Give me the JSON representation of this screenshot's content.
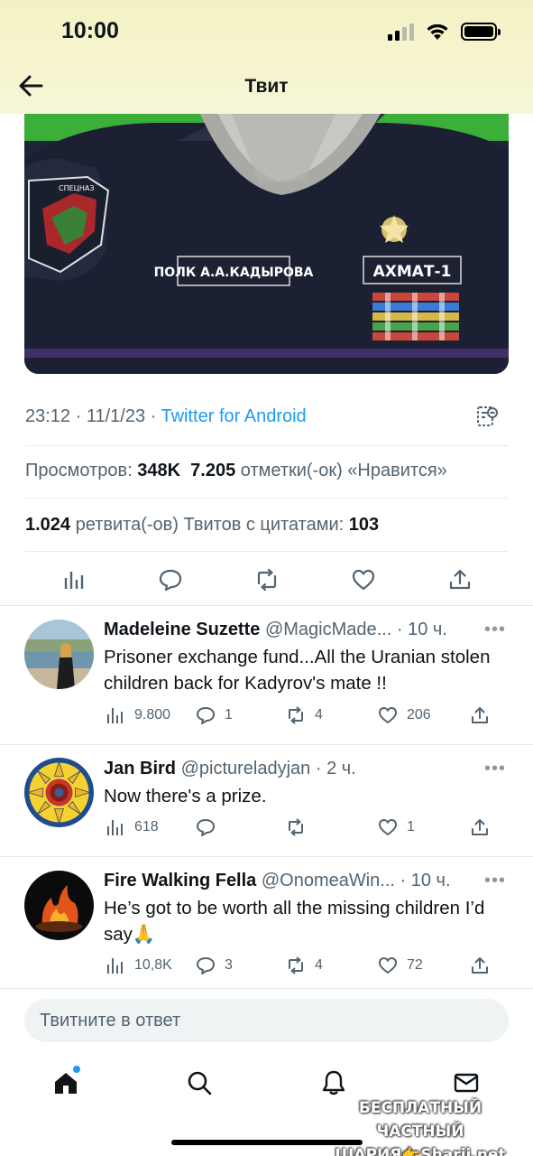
{
  "status_bar": {
    "time": "10:00"
  },
  "header": {
    "title": "Твит"
  },
  "tweet": {
    "image": {
      "patch_left_text": "СПЕЦНАЗ",
      "name_tag": "ПОЛК А.А.КАДЫРОВА",
      "unit_tag": "АХМАТ-1"
    },
    "timestamp": "23:12 · 11/1/23 · ",
    "source": "Twitter for Android",
    "views_label": "Просмотров: ",
    "views_count": "348K",
    "likes_count": "7.205",
    "likes_label": " отметки(-ок) «Нравится»",
    "retweets_count": "1.024",
    "retweets_label": " ретвита(-ов)  Твитов с цитатами: ",
    "quotes_count": "103"
  },
  "replies": [
    {
      "name": "Madeleine Suzette",
      "handle": " @MagicMade... · 10 ч.",
      "text": "Prisoner exchange fund...All the Uranian stolen children back for Kadyrov's mate !!",
      "views": "9.800",
      "comments": "1",
      "retweets": "4",
      "likes": "206"
    },
    {
      "name": "Jan Bird",
      "handle": " @pictureladyjan · 2 ч.",
      "text": "Now there's a prize.",
      "views": "618",
      "comments": "",
      "retweets": "",
      "likes": "1"
    },
    {
      "name": "Fire Walking Fella",
      "handle": " @OnomeaWin... · 10 ч.",
      "text": "He’s got to be worth all the missing children I’d say🙏",
      "views": "10,8K",
      "comments": "3",
      "retweets": "4",
      "likes": "72"
    }
  ],
  "more_label": "•••",
  "compose": {
    "placeholder": "Твитните в ответ"
  },
  "watermark": {
    "line1": "БЕСПЛАТНЫЙ ЧАСТНЫЙ",
    "line2": "ШАРИЯ👉Sharij.net"
  }
}
